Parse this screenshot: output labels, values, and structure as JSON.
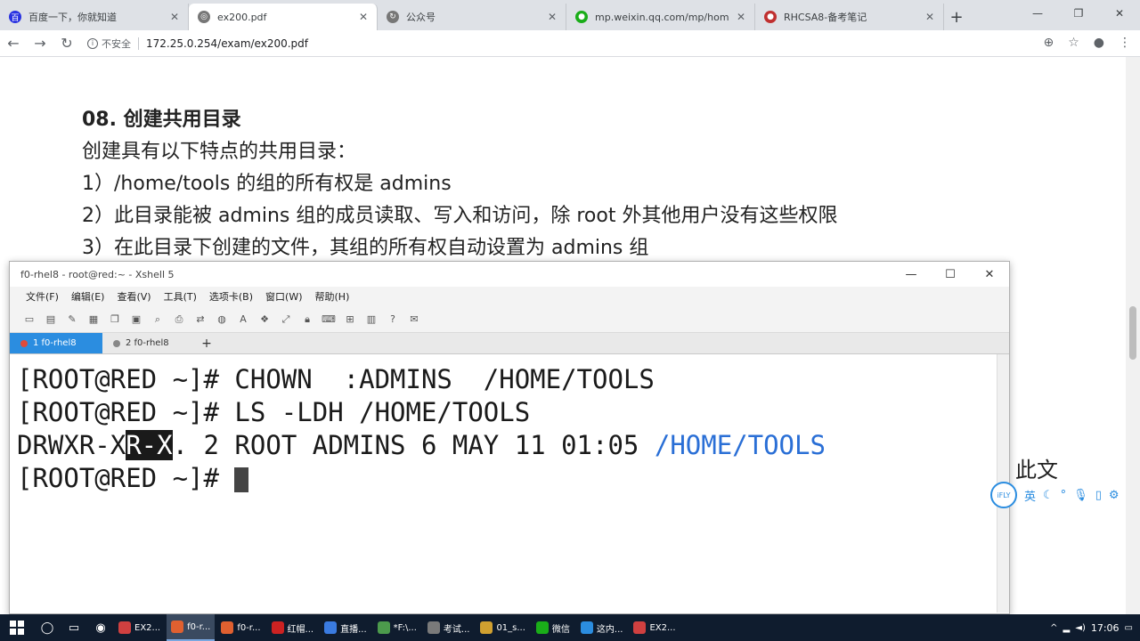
{
  "browser": {
    "tabs": [
      {
        "label": "百度一下，你就知道",
        "favicon_color": "#2932e1",
        "active": false
      },
      {
        "label": "ex200.pdf",
        "favicon_color": "#777777",
        "active": true
      },
      {
        "label": "公众号",
        "favicon_color": "#777777",
        "active": false
      },
      {
        "label": "mp.weixin.qq.com/mp/hom",
        "favicon_color": "#1aad19",
        "active": false
      },
      {
        "label": "RHCSA8-备考笔记",
        "favicon_color": "#c03030",
        "active": false
      }
    ],
    "security_label": "不安全",
    "url": "172.25.0.254/exam/ex200.pdf"
  },
  "pdf": {
    "section_title": "08. 创建共用目录",
    "intro": "创建具有以下特点的共用目录：",
    "items": [
      "1）/home/tools 的组的所有权是 admins",
      "2）此目录能被 admins 组的成员读取、写入和访问，除 root 外其他用户没有这些权限",
      "3）在此目录下创建的文件，其组的所有权自动设置为 admins 组"
    ]
  },
  "xshell": {
    "title": "f0-rhel8 - root@red:~ - Xshell 5",
    "menu": [
      "文件(F)",
      "编辑(E)",
      "查看(V)",
      "工具(T)",
      "选项卡(B)",
      "窗口(W)",
      "帮助(H)"
    ],
    "tabs": [
      "1 f0-rhel8",
      "2 f0-rhel8"
    ],
    "terminal": {
      "line1": "[ROOT@RED ~]# CHOWN  :ADMINS  /HOME/TOOLS",
      "line2": "[ROOT@RED ~]# LS -LDH /HOME/TOOLS",
      "line3_perm_a": "DRWXR-X",
      "line3_perm_sel": "R-X",
      "line3_rest": ". 2 ROOT ADMINS 6 MAY 11 01:05 ",
      "line3_dir": "/HOME/TOOLS",
      "line4": "[ROOT@RED ~]# "
    }
  },
  "ime": {
    "float_text": "此文",
    "mode": "英"
  },
  "taskbar": {
    "tasks": [
      {
        "label": "EX2...",
        "color": "#d04040",
        "active": false
      },
      {
        "label": "f0-r...",
        "color": "#e06030",
        "active": true
      },
      {
        "label": "f0-r...",
        "color": "#e06030",
        "active": false
      },
      {
        "label": "红帽...",
        "color": "#cc2222",
        "active": false
      },
      {
        "label": "直播...",
        "color": "#3a7be0",
        "active": false
      },
      {
        "label": "*F:\\...",
        "color": "#4c9a4c",
        "active": false
      },
      {
        "label": "考试...",
        "color": "#7a7a7a",
        "active": false
      },
      {
        "label": "01_s...",
        "color": "#d0a030",
        "active": false
      },
      {
        "label": "微信",
        "color": "#1aad19",
        "active": false
      },
      {
        "label": "这内...",
        "color": "#2b8de0",
        "active": false
      },
      {
        "label": "EX2...",
        "color": "#d04040",
        "active": false
      }
    ],
    "clock": "17:06"
  }
}
